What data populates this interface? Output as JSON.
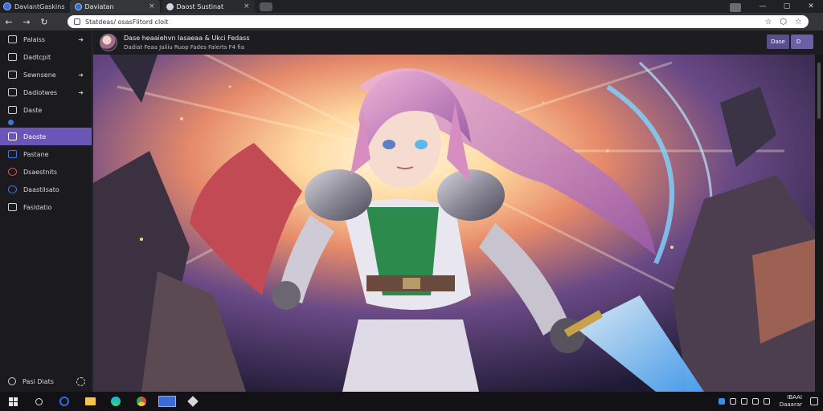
{
  "browser": {
    "app_label": "DaviantGaskins",
    "tabs": [
      {
        "title": "Daviatan",
        "state": "active"
      },
      {
        "title": "Daost Sustinat",
        "state": "inactive"
      }
    ],
    "address_bar": {
      "url": "Statdeas/ osasFlitord cloit"
    }
  },
  "sidebar": {
    "items": [
      {
        "label": "Palaiss",
        "has_chevron": true
      },
      {
        "label": "Dadtcpit",
        "has_chevron": false
      },
      {
        "label": "Sewnsene",
        "has_chevron": true
      },
      {
        "label": "Dadiotwes",
        "has_chevron": true
      },
      {
        "label": "Daste",
        "has_chevron": false
      },
      {
        "label": "Daoste",
        "active": true
      },
      {
        "label": "Pastane",
        "has_chevron": false
      },
      {
        "label": "Dsaestnits",
        "has_chevron": false
      },
      {
        "label": "Daastilsato",
        "has_chevron": false
      },
      {
        "label": "Fasldatio",
        "has_chevron": false
      }
    ],
    "footer": {
      "label": "Pasi Diats"
    }
  },
  "content_header": {
    "title": "Dase heaaiehvn Iasaeaa & Ukci Fedass",
    "subtitle": "Dadiat Feaa Jaliiu Ruop Fades Falerts F4 fia",
    "buttons": [
      "Dase",
      "D    "
    ]
  },
  "artwork": {
    "alt": "anime-knight-illustration",
    "subject": "knight-heroine-with-glowing-sword"
  },
  "taskbar": {
    "tray_time": "IBAAI",
    "tray_date": "Daaarar"
  },
  "colors": {
    "accent": "#6b55b8",
    "browser_bg": "#202124",
    "sidebar_bg": "#1b1b1f"
  }
}
